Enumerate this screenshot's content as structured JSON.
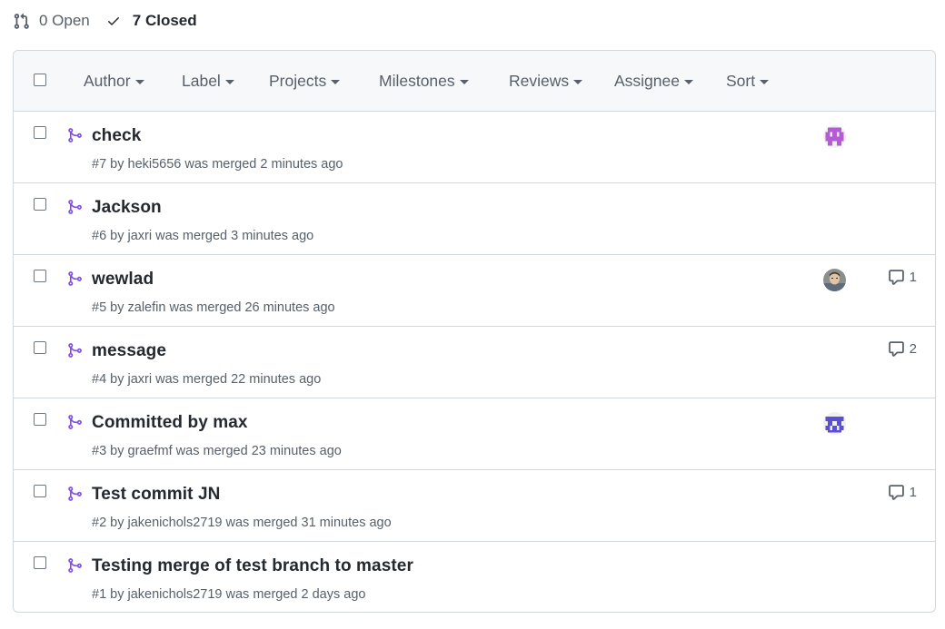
{
  "states": {
    "open_label": "0 Open",
    "closed_label": "7 Closed"
  },
  "filters": [
    {
      "label": "Author"
    },
    {
      "label": "Label"
    },
    {
      "label": "Projects"
    },
    {
      "label": "Milestones"
    },
    {
      "label": "Reviews"
    },
    {
      "label": "Assignee"
    },
    {
      "label": "Sort"
    }
  ],
  "pull_requests": [
    {
      "title": "check",
      "meta": "#7 by heki5656 was merged 2 minutes ago",
      "avatar": "identicon-purple",
      "comments": ""
    },
    {
      "title": "Jackson",
      "meta": "#6 by jaxri was merged 3 minutes ago",
      "avatar": "",
      "comments": ""
    },
    {
      "title": "wewlad",
      "meta": "#5 by zalefin was merged 26 minutes ago",
      "avatar": "photo",
      "comments": "1"
    },
    {
      "title": "message",
      "meta": "#4 by jaxri was merged 22 minutes ago",
      "avatar": "",
      "comments": "2"
    },
    {
      "title": "Committed by max",
      "meta": "#3 by graefmf was merged 23 minutes ago",
      "avatar": "identicon-blue",
      "comments": ""
    },
    {
      "title": "Test commit JN",
      "meta": "#2 by jakenichols2719 was merged 31 minutes ago",
      "avatar": "",
      "comments": "1"
    },
    {
      "title": "Testing merge of test branch to master",
      "meta": "#1 by jakenichols2719 was merged 2 days ago",
      "avatar": "",
      "comments": ""
    }
  ],
  "colors": {
    "merged": "#8250df",
    "text": "#24292f",
    "muted": "#57606a",
    "border": "#d0d7de",
    "header_bg": "#f6f8fa"
  }
}
